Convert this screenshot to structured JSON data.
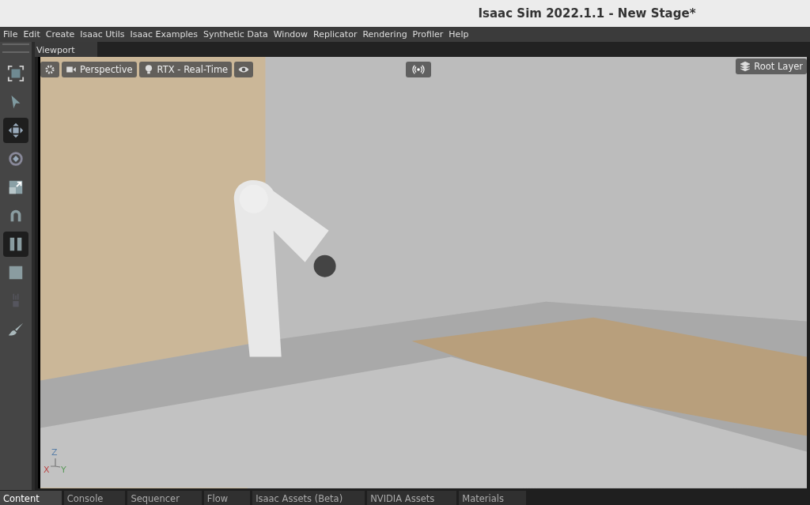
{
  "window": {
    "title": "Isaac Sim 2022.1.1 - New Stage*"
  },
  "menu": [
    "File",
    "Edit",
    "Create",
    "Isaac Utils",
    "Isaac Examples",
    "Synthetic Data",
    "Window",
    "Replicator",
    "Rendering",
    "Profiler",
    "Help"
  ],
  "toolbar": [
    {
      "kind": "select-mode",
      "selected": false,
      "disabled": false
    },
    {
      "kind": "pointer",
      "selected": false,
      "disabled": false
    },
    {
      "kind": "move",
      "selected": true,
      "disabled": false
    },
    {
      "kind": "rotate",
      "selected": false,
      "disabled": false
    },
    {
      "kind": "scale",
      "selected": false,
      "disabled": false
    },
    {
      "kind": "snap",
      "selected": false,
      "disabled": false
    },
    {
      "kind": "pause",
      "selected": true,
      "disabled": false
    },
    {
      "kind": "stop",
      "selected": false,
      "disabled": false
    },
    {
      "kind": "physics",
      "selected": false,
      "disabled": true
    },
    {
      "kind": "paint",
      "selected": false,
      "disabled": false
    }
  ],
  "viewport": {
    "tab": "Viewport",
    "camera": "Perspective",
    "renderer": "RTX - Real-Time",
    "layer": "Root Layer",
    "axes": {
      "x": "X",
      "y": "Y",
      "z": "Z"
    }
  },
  "bottom_tabs": [
    {
      "label": "Content",
      "selected": true
    },
    {
      "label": "Console",
      "selected": false
    },
    {
      "label": "Sequencer",
      "selected": false
    },
    {
      "label": "Flow",
      "selected": false
    },
    {
      "label": "Isaac Assets (Beta)",
      "selected": false
    },
    {
      "label": "NVIDIA Assets",
      "selected": false
    },
    {
      "label": "Materials",
      "selected": false
    }
  ]
}
